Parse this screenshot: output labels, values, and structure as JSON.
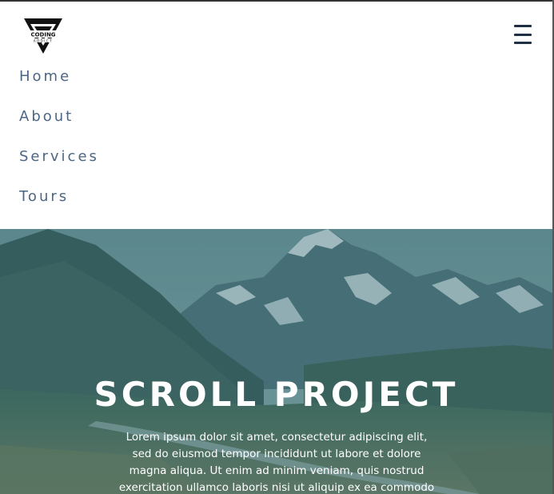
{
  "brand": {
    "logo_icon": "coding-addict-logo",
    "logo_text": "CODING",
    "logo_subtext": "ADDICT"
  },
  "nav": {
    "toggle_icon": "hamburger-menu-icon",
    "links": [
      {
        "label": "Home"
      },
      {
        "label": "About"
      },
      {
        "label": "Services"
      },
      {
        "label": "Tours"
      }
    ]
  },
  "hero": {
    "title": "SCROLL PROJECT",
    "text": "Lorem ipsum dolor sit amet, consectetur adipiscing elit, sed do eiusmod tempor incididunt ut labore et dolore magna aliqua. Ut enim ad minim veniam, quis nostrud exercitation ullamco laboris nisi ut aliquip ex ea commodo consequat.",
    "background": "mountain-valley-image"
  },
  "colors": {
    "nav_link": "#4b6785",
    "toggle": "#1f2f44",
    "hero_overlay": "#366e78"
  }
}
